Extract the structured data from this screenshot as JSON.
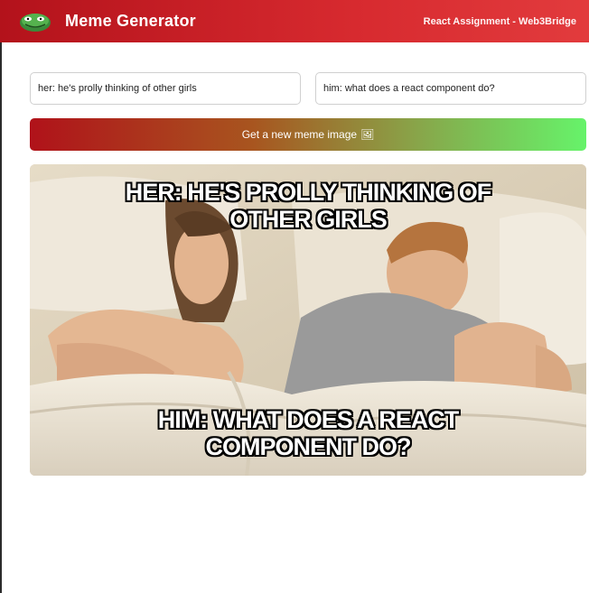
{
  "header": {
    "title": "Meme Generator",
    "subtitle": "React Assignment - Web3Bridge",
    "logo_icon": "troll-face-icon"
  },
  "form": {
    "top_text": "her: he's prolly thinking of other girls",
    "bottom_text": "him: what does a react component do?",
    "button_label": "Get a new meme image",
    "button_icon": "🖼"
  },
  "meme": {
    "template": "I Bet He's Thinking About Other Women",
    "top_caption": "her: he's prolly thinking of other girls",
    "bottom_caption": "him: what does a react component do?"
  },
  "colors": {
    "header_start": "#b3121b",
    "header_end": "#e23b3d",
    "button_start": "#b0121a",
    "button_end": "#66f36a"
  }
}
